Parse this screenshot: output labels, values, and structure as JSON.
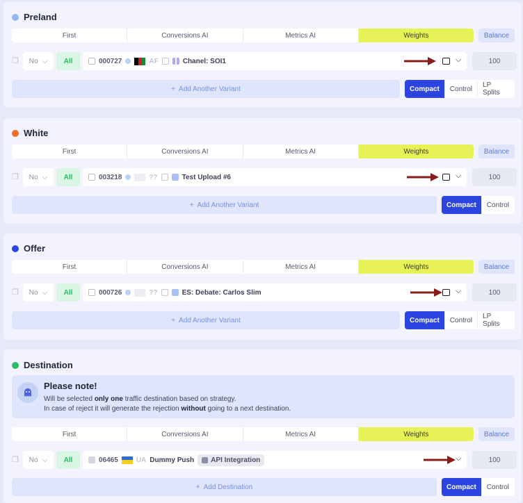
{
  "tabs": [
    "First",
    "Conversions AI",
    "Metrics AI",
    "Weights"
  ],
  "balance_label": "Balance",
  "no_label": "No",
  "all_label": "All",
  "weight_value": "100",
  "sections": {
    "preland": {
      "title": "Preland",
      "color": "#93b8f0",
      "variant": {
        "id": "000727",
        "geo": "AF",
        "name": "Chanel: SOI1"
      },
      "add_label": "Add Another Variant",
      "modes": [
        "Compact",
        "Control",
        "LP Splits"
      ]
    },
    "white": {
      "title": "White",
      "color": "#f06a2c",
      "variant": {
        "id": "003218",
        "geo": "??",
        "name": "Test Upload #6"
      },
      "add_label": "Add Another Variant",
      "modes": [
        "Compact",
        "Control"
      ]
    },
    "offer": {
      "title": "Offer",
      "color": "#2d45e0",
      "variant": {
        "id": "000726",
        "geo": "??",
        "name": "ES: Debate: Carlos Slim"
      },
      "add_label": "Add Another Variant",
      "modes": [
        "Compact",
        "Control",
        "LP Splits"
      ]
    },
    "destination": {
      "title": "Destination",
      "color": "#2dbb63",
      "note": {
        "title": "Please note!",
        "line1_pre": "Will be selected ",
        "line1_bold": "only one",
        "line1_post": " traffic destination based on strategy.",
        "line2_pre": "In case of reject it will generate the rejection ",
        "line2_bold": "without",
        "line2_post": " going to a next destination."
      },
      "variant": {
        "id": "06465",
        "geo": "UA",
        "name": "Dummy Push",
        "chip": "API Integration"
      },
      "add_label": "Add Destination",
      "modes": [
        "Compact",
        "Control"
      ]
    }
  },
  "colors": {
    "accent": "#2d45e0",
    "weights_tab": "#e7f257",
    "arrow": "#8b1a1a"
  }
}
